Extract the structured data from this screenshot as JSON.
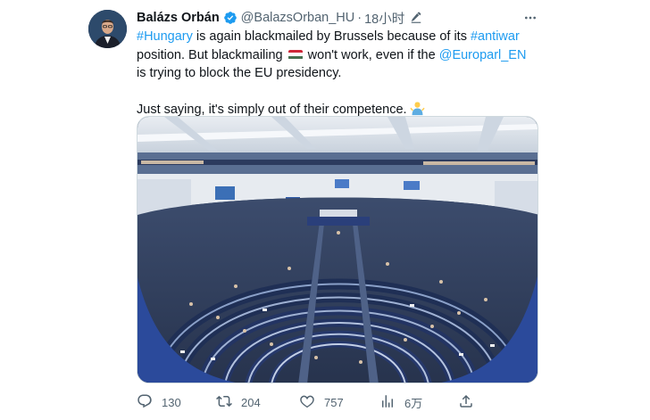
{
  "author": {
    "name": "Balázs Orbán",
    "handle": "@BalazsOrban_HU",
    "time": "18小时",
    "verified": true
  },
  "tweet": {
    "hashtag_1": "#Hungary",
    "text_1": " is again blackmailed by Brussels because of its ",
    "hashtag_2": "#antiwar",
    "text_2": " position. But blackmailing ",
    "text_3": " won't work, even if the ",
    "mention": "@Europarl_EN",
    "text_4": " is trying to block the EU presidency.",
    "text_5": "Just saying, it's simply out of their competence."
  },
  "media": {
    "alt": "European Parliament plenary chamber"
  },
  "actions": {
    "replies": "130",
    "retweets": "204",
    "likes": "757",
    "views": "6万"
  },
  "icons": {
    "verified": "verified-badge-icon",
    "edit": "edit-pencil-icon",
    "more": "more-options-icon",
    "reply": "reply-icon",
    "retweet": "retweet-icon",
    "like": "like-icon",
    "views": "views-icon",
    "share": "share-icon"
  },
  "colors": {
    "link": "#1d9bf0",
    "secondary_text": "#536471",
    "primary_text": "#0f1419"
  }
}
